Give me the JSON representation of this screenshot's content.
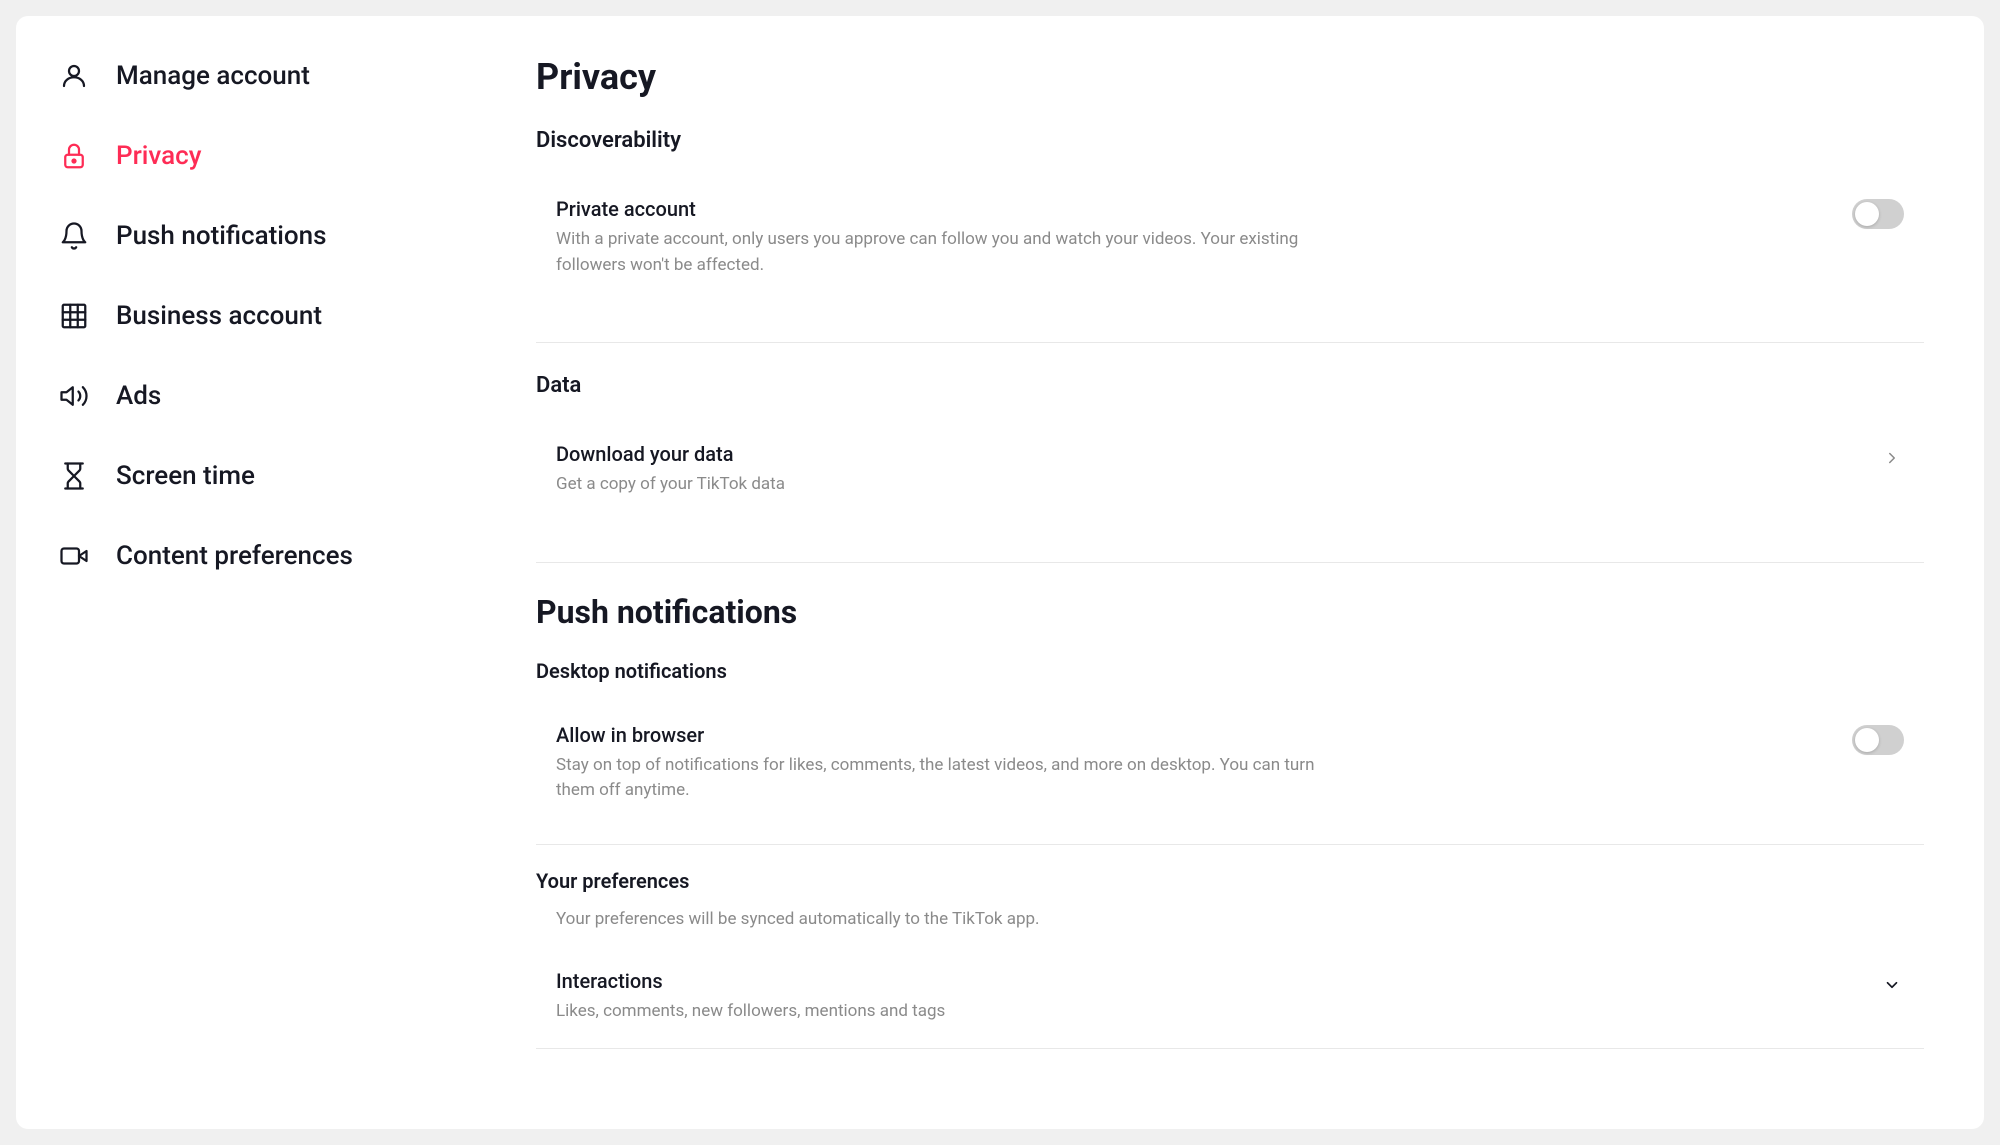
{
  "sidebar": {
    "items": [
      {
        "id": "manage-account",
        "label": "Manage account",
        "icon": "person",
        "active": false
      },
      {
        "id": "privacy",
        "label": "Privacy",
        "icon": "lock",
        "active": true
      },
      {
        "id": "push-notifications",
        "label": "Push notifications",
        "icon": "bell",
        "active": false
      },
      {
        "id": "business-account",
        "label": "Business account",
        "icon": "building",
        "active": false
      },
      {
        "id": "ads",
        "label": "Ads",
        "icon": "megaphone",
        "active": false
      },
      {
        "id": "screen-time",
        "label": "Screen time",
        "icon": "hourglass",
        "active": false
      },
      {
        "id": "content-preferences",
        "label": "Content preferences",
        "icon": "video",
        "active": false
      }
    ]
  },
  "main": {
    "page_title": "Privacy",
    "sections": [
      {
        "id": "discoverability",
        "title": "Discoverability",
        "items": [
          {
            "id": "private-account",
            "label": "Private account",
            "description": "With a private account, only users you approve can follow you and watch your videos. Your existing followers won't be affected.",
            "control": "toggle",
            "enabled": false
          }
        ]
      },
      {
        "id": "data",
        "title": "Data",
        "items": [
          {
            "id": "download-data",
            "label": "Download your data",
            "description": "Get a copy of your TikTok data",
            "control": "chevron-right"
          }
        ]
      }
    ],
    "push_notifications_section": {
      "title": "Push notifications",
      "subsections": [
        {
          "id": "desktop-notifications",
          "title": "Desktop notifications",
          "items": [
            {
              "id": "allow-in-browser",
              "label": "Allow in browser",
              "description": "Stay on top of notifications for likes, comments, the latest videos, and more on desktop. You can turn them off anytime.",
              "control": "toggle",
              "enabled": false
            }
          ]
        },
        {
          "id": "your-preferences",
          "title": "Your preferences",
          "description": "Your preferences will be synced automatically to the TikTok app.",
          "items": [
            {
              "id": "interactions",
              "label": "Interactions",
              "description": "Likes, comments, new followers, mentions and tags",
              "control": "chevron-down"
            }
          ]
        }
      ]
    }
  },
  "colors": {
    "active": "#fe2c55",
    "text_primary": "#161823",
    "text_secondary": "#8a8a8a",
    "toggle_off": "#d0d0d0",
    "divider": "#e8e8e8"
  }
}
